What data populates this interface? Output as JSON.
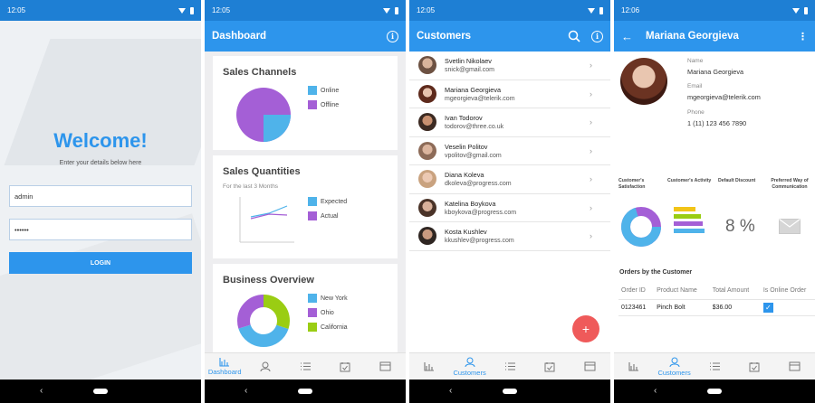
{
  "login": {
    "time": "12:05",
    "welcome": "Welcome!",
    "subtitle": "Enter your details below here",
    "username": "admin",
    "password": "••••••",
    "login_button": "LOGIN"
  },
  "dashboard": {
    "time": "12:05",
    "title": "Dashboard",
    "sales_channels": {
      "title": "Sales Channels",
      "legend": [
        "Online",
        "Offline"
      ]
    },
    "sales_quantities": {
      "title": "Sales Quantities",
      "subtitle": "For the last 3 Months",
      "legend": [
        "Expected",
        "Actual"
      ]
    },
    "business_overview": {
      "title": "Business Overview",
      "legend": [
        "New York",
        "Ohio",
        "California"
      ]
    },
    "active_tab_label": "Dashboard"
  },
  "customers": {
    "time": "12:05",
    "title": "Customers",
    "rows": [
      {
        "name": "Svetlin Nikolaev",
        "email": "snick@gmail.com"
      },
      {
        "name": "Mariana Georgieva",
        "email": "mgeorgieva@telerik.com"
      },
      {
        "name": "Ivan Todorov",
        "email": "todorov@three.co.uk"
      },
      {
        "name": "Veselin Politov",
        "email": "vpolitov@gmail.com"
      },
      {
        "name": "Diana Koleva",
        "email": "dkoleva@progress.com"
      },
      {
        "name": "Katelina Boykova",
        "email": "kboykova@progress.com"
      },
      {
        "name": "Kosta Kushlev",
        "email": "kkushlev@progress.com"
      }
    ],
    "fab": "+",
    "active_tab_label": "Customers"
  },
  "detail": {
    "time": "12:06",
    "title": "Mariana Georgieva",
    "name_label": "Name",
    "name": "Mariana Georgieva",
    "email_label": "Email",
    "email": "mgeorgieva@telerik.com",
    "phone_label": "Phone",
    "phone": "1 (11) 123 456 7890",
    "stat_headers": [
      "Customer's Satisfaction",
      "Customer's Activity",
      "Default Discount",
      "Preferred Way of Communication"
    ],
    "discount": "8 %",
    "orders_title": "Orders by the Customer",
    "orders_columns": [
      "Order ID",
      "Product Name",
      "Total Amount",
      "Is Online Order"
    ],
    "orders": [
      {
        "id": "0123461",
        "product": "Pinch Bolt",
        "amount": "$36.00",
        "online": true
      }
    ],
    "active_tab_label": "Customers"
  },
  "colors": {
    "primary": "#2d95ec",
    "statusbar": "#1e7fd4",
    "chart_blue": "#4fb3ea",
    "chart_purple": "#a45fd6",
    "chart_green": "#9acd13",
    "fab": "#ef5a5a"
  }
}
